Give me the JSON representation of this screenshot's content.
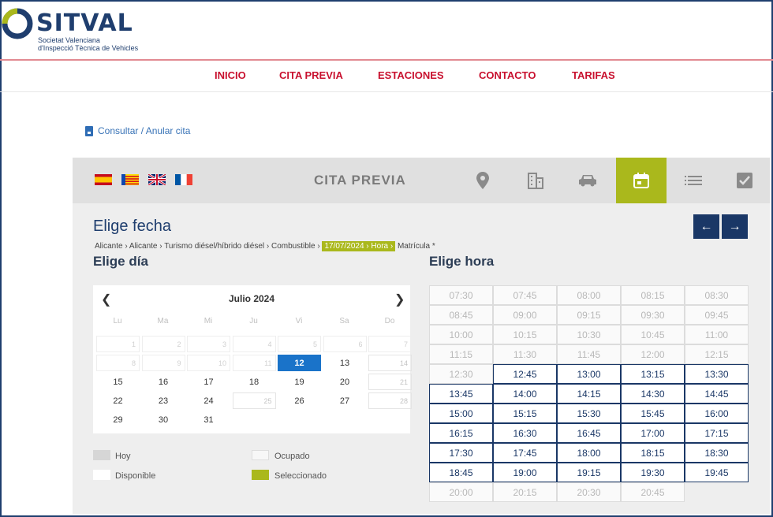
{
  "brand": {
    "name": "SITVAL",
    "sub_line1": "Societat Valenciana",
    "sub_line2": "d'Inspecció Tècnica de Vehicles"
  },
  "nav": [
    "INICIO",
    "CITA PREVIA",
    "ESTACIONES",
    "CONTACTO",
    "TARIFAS"
  ],
  "consult_link": "Consultar / Anular cita",
  "panel": {
    "title": "CITA PREVIA",
    "languages": [
      "es-flag-icon",
      "va-flag-icon",
      "uk-flag-icon",
      "fr-flag-icon"
    ],
    "steps": [
      "location-pin-icon",
      "building-icon",
      "car-icon",
      "calendar-icon",
      "list-icon",
      "check-icon"
    ],
    "active_step": "calendar-icon",
    "accent_color": "#aab81c",
    "nav_color": "#1a3766"
  },
  "heading_fecha": "Elige fecha",
  "breadcrumb": {
    "plain": "Alicante › Alicante › Turismo diésel/híbrido diésel › Combustible › ",
    "highlight": "17/07/2024 › Hora ›",
    "rest": " Matrícula *"
  },
  "heading_dia": "Elige día",
  "heading_hora": "Elige hora",
  "calendar": {
    "month": "Julio 2024",
    "weekdays": [
      "Lu",
      "Ma",
      "Mi",
      "Ju",
      "Vi",
      "Sa",
      "Do"
    ],
    "rows": [
      [
        {
          "d": "1",
          "s": "past"
        },
        {
          "d": "2",
          "s": "past"
        },
        {
          "d": "3",
          "s": "past"
        },
        {
          "d": "4",
          "s": "past"
        },
        {
          "d": "5",
          "s": "past"
        },
        {
          "d": "6",
          "s": "past"
        },
        {
          "d": "7",
          "s": "past"
        }
      ],
      [
        {
          "d": "8",
          "s": "past"
        },
        {
          "d": "9",
          "s": "past"
        },
        {
          "d": "10",
          "s": "past"
        },
        {
          "d": "11",
          "s": "past"
        },
        {
          "d": "12",
          "s": "sel"
        },
        {
          "d": "13",
          "s": "cur"
        },
        {
          "d": "14",
          "s": "busy"
        }
      ],
      [
        {
          "d": "15",
          "s": "avail"
        },
        {
          "d": "16",
          "s": "avail"
        },
        {
          "d": "17",
          "s": "avail"
        },
        {
          "d": "18",
          "s": "avail"
        },
        {
          "d": "19",
          "s": "avail"
        },
        {
          "d": "20",
          "s": "avail"
        },
        {
          "d": "21",
          "s": "busy"
        }
      ],
      [
        {
          "d": "22",
          "s": "avail"
        },
        {
          "d": "23",
          "s": "avail"
        },
        {
          "d": "24",
          "s": "avail"
        },
        {
          "d": "25",
          "s": "busy"
        },
        {
          "d": "26",
          "s": "avail"
        },
        {
          "d": "27",
          "s": "avail"
        },
        {
          "d": "28",
          "s": "busy"
        }
      ],
      [
        {
          "d": "29",
          "s": "avail"
        },
        {
          "d": "30",
          "s": "avail"
        },
        {
          "d": "31",
          "s": "avail"
        }
      ]
    ]
  },
  "legend": {
    "hoy": "Hoy",
    "ocupado": "Ocupado",
    "disponible": "Disponible",
    "seleccionado": "Seleccionado"
  },
  "times": [
    {
      "t": "07:30",
      "a": false
    },
    {
      "t": "07:45",
      "a": false
    },
    {
      "t": "08:00",
      "a": false
    },
    {
      "t": "08:15",
      "a": false
    },
    {
      "t": "08:30",
      "a": false
    },
    {
      "t": "08:45",
      "a": false
    },
    {
      "t": "09:00",
      "a": false
    },
    {
      "t": "09:15",
      "a": false
    },
    {
      "t": "09:30",
      "a": false
    },
    {
      "t": "09:45",
      "a": false
    },
    {
      "t": "10:00",
      "a": false
    },
    {
      "t": "10:15",
      "a": false
    },
    {
      "t": "10:30",
      "a": false
    },
    {
      "t": "10:45",
      "a": false
    },
    {
      "t": "11:00",
      "a": false
    },
    {
      "t": "11:15",
      "a": false
    },
    {
      "t": "11:30",
      "a": false
    },
    {
      "t": "11:45",
      "a": false
    },
    {
      "t": "12:00",
      "a": false
    },
    {
      "t": "12:15",
      "a": false
    },
    {
      "t": "12:30",
      "a": false
    },
    {
      "t": "12:45",
      "a": true
    },
    {
      "t": "13:00",
      "a": true
    },
    {
      "t": "13:15",
      "a": true
    },
    {
      "t": "13:30",
      "a": true
    },
    {
      "t": "13:45",
      "a": true
    },
    {
      "t": "14:00",
      "a": true
    },
    {
      "t": "14:15",
      "a": true
    },
    {
      "t": "14:30",
      "a": true
    },
    {
      "t": "14:45",
      "a": true
    },
    {
      "t": "15:00",
      "a": true
    },
    {
      "t": "15:15",
      "a": true
    },
    {
      "t": "15:30",
      "a": true
    },
    {
      "t": "15:45",
      "a": true
    },
    {
      "t": "16:00",
      "a": true
    },
    {
      "t": "16:15",
      "a": true
    },
    {
      "t": "16:30",
      "a": true
    },
    {
      "t": "16:45",
      "a": true
    },
    {
      "t": "17:00",
      "a": true
    },
    {
      "t": "17:15",
      "a": true
    },
    {
      "t": "17:30",
      "a": true
    },
    {
      "t": "17:45",
      "a": true
    },
    {
      "t": "18:00",
      "a": true
    },
    {
      "t": "18:15",
      "a": true
    },
    {
      "t": "18:30",
      "a": true
    },
    {
      "t": "18:45",
      "a": true
    },
    {
      "t": "19:00",
      "a": true
    },
    {
      "t": "19:15",
      "a": true
    },
    {
      "t": "19:30",
      "a": true
    },
    {
      "t": "19:45",
      "a": true
    },
    {
      "t": "20:00",
      "a": false
    },
    {
      "t": "20:15",
      "a": false
    },
    {
      "t": "20:30",
      "a": false
    },
    {
      "t": "20:45",
      "a": false
    }
  ]
}
